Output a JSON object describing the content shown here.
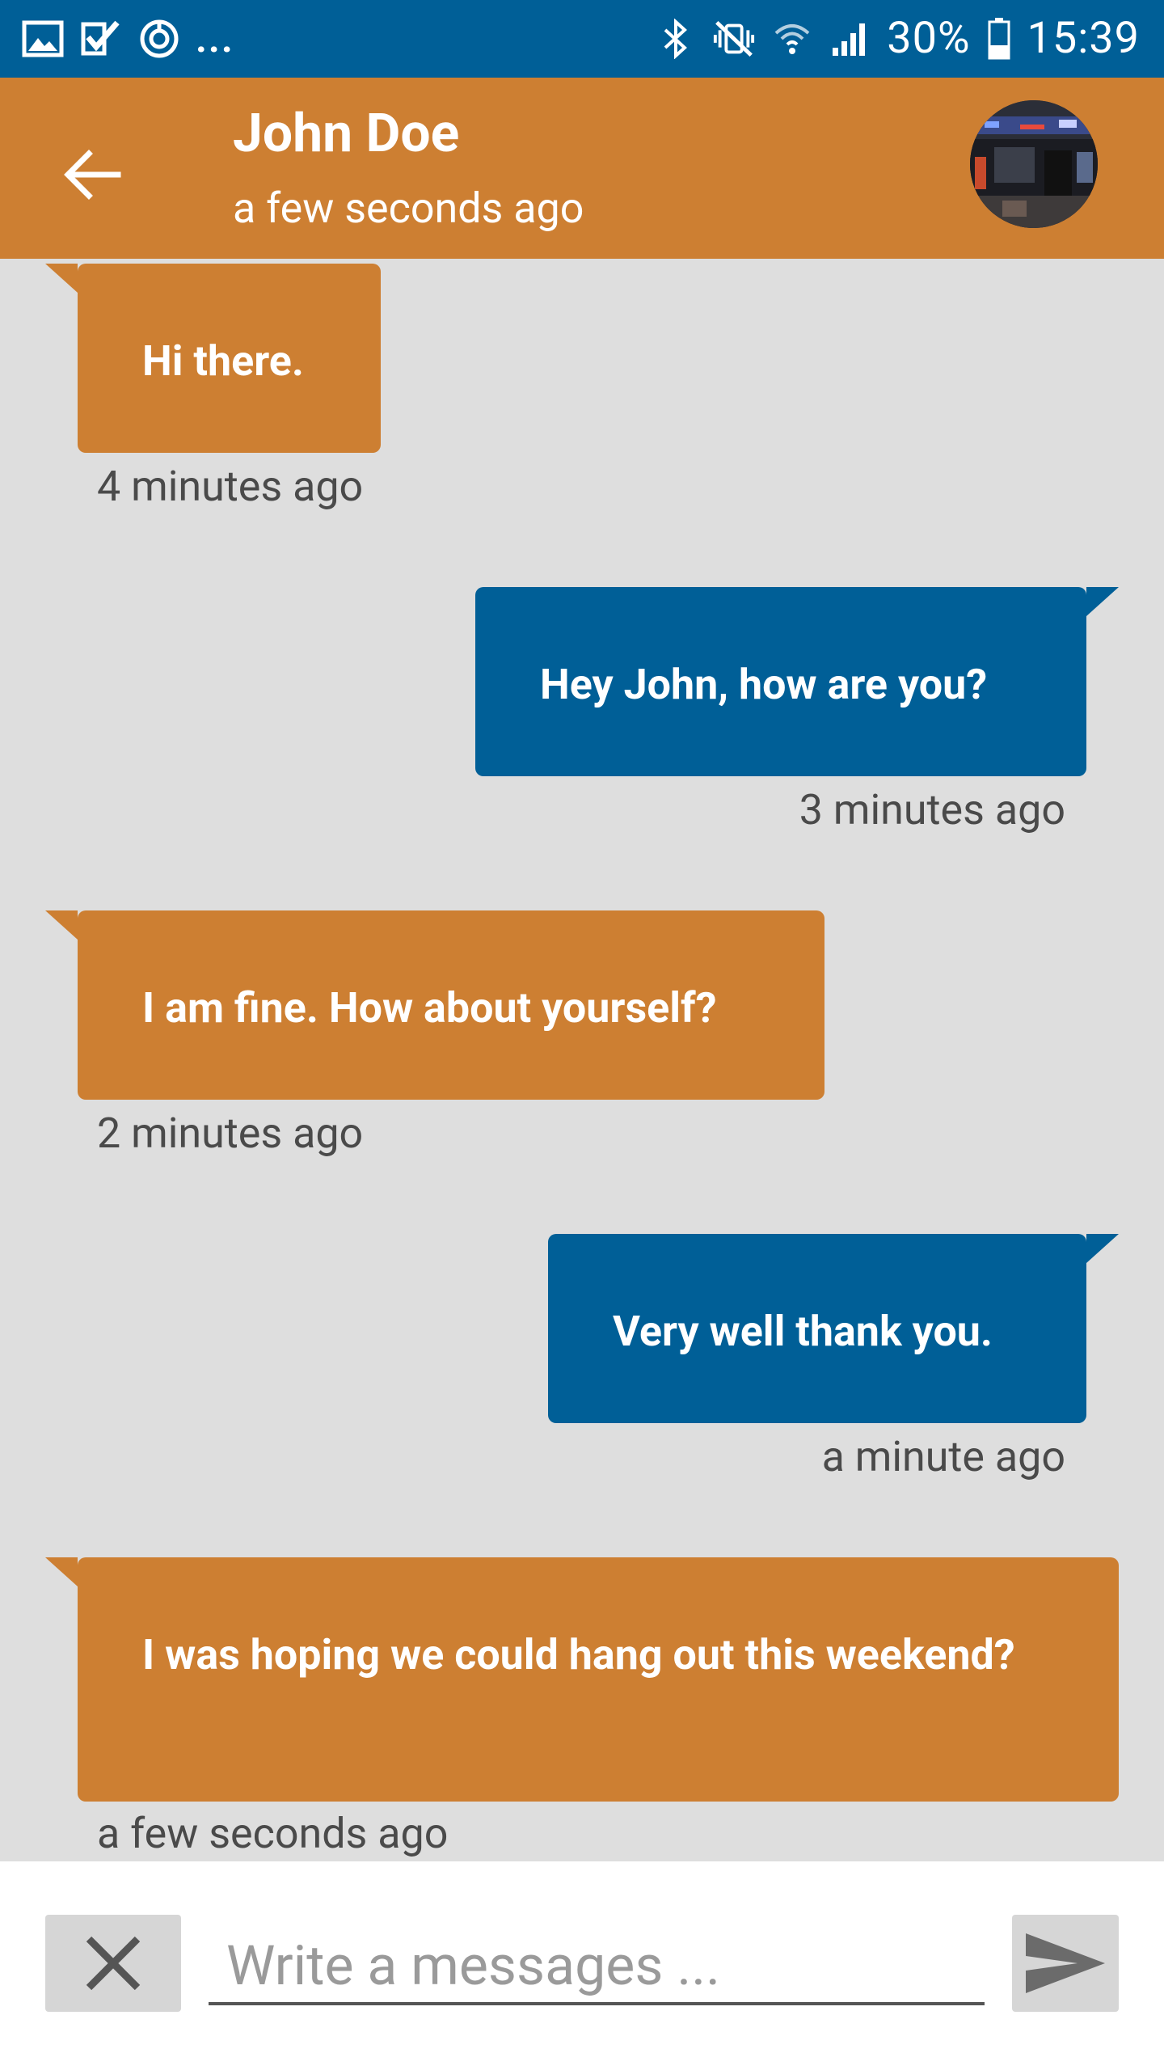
{
  "status_bar": {
    "left_icons": [
      "image-icon",
      "checkbox-icon",
      "sync-icon"
    ],
    "overflow": "...",
    "battery_percent": "30%",
    "time": "15:39"
  },
  "header": {
    "contact_name": "John Doe",
    "contact_status": "a few seconds ago"
  },
  "messages": [
    {
      "direction": "incoming",
      "text": "Hi there.",
      "time": "4 minutes ago"
    },
    {
      "direction": "outgoing",
      "text": "Hey John, how are you?",
      "time": "3 minutes ago"
    },
    {
      "direction": "incoming",
      "text": "I am fine. How about yourself?",
      "time": "2 minutes ago"
    },
    {
      "direction": "outgoing",
      "text": "Very well thank you.",
      "time": "a minute ago"
    },
    {
      "direction": "incoming",
      "text": "I was hoping we could hang out this weekend?",
      "time": "a few seconds ago"
    }
  ],
  "composer": {
    "placeholder": "Write a messages ..."
  },
  "colors": {
    "primary": "#005f97",
    "accent": "#cd7f32",
    "background": "#dedede"
  }
}
